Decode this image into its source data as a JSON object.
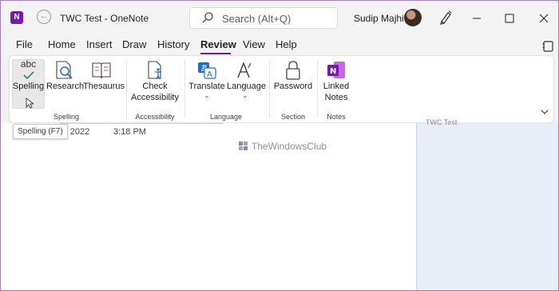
{
  "window": {
    "title": "TWC Test  -  OneNote",
    "app_icon_letter": "N",
    "user_name": "Sudip Majhi"
  },
  "search": {
    "placeholder": "Search (Alt+Q)"
  },
  "tabs": [
    {
      "label": "File"
    },
    {
      "label": "Home"
    },
    {
      "label": "Insert"
    },
    {
      "label": "Draw"
    },
    {
      "label": "History"
    },
    {
      "label": "Review",
      "active": true
    },
    {
      "label": "View"
    },
    {
      "label": "Help"
    }
  ],
  "ribbon": {
    "spelling": {
      "icon_text": "abc",
      "label": "Spelling"
    },
    "research": {
      "label": "Research"
    },
    "thesaurus": {
      "label": "Thesaurus"
    },
    "check_accessibility": {
      "line1": "Check",
      "line2": "Accessibility"
    },
    "translate": {
      "label": "Translate"
    },
    "language": {
      "label": "Language"
    },
    "password": {
      "label": "Password"
    },
    "linked_notes": {
      "line1": "Linked",
      "line2": "Notes"
    },
    "groups": {
      "spelling": "Spelling",
      "accessibility": "Accessibility",
      "language": "Language",
      "section": "Section",
      "notes": "Notes"
    }
  },
  "tooltip": "Spelling (F7)",
  "page": {
    "date": "y, 2022",
    "time": "3:18 PM",
    "page_list_item": "TWC Test"
  },
  "watermark": "TheWindowsClub",
  "colors": {
    "accent": "#7719aa",
    "page_list_bg": "#e8eef8",
    "window_border": "#9a7fb8"
  }
}
